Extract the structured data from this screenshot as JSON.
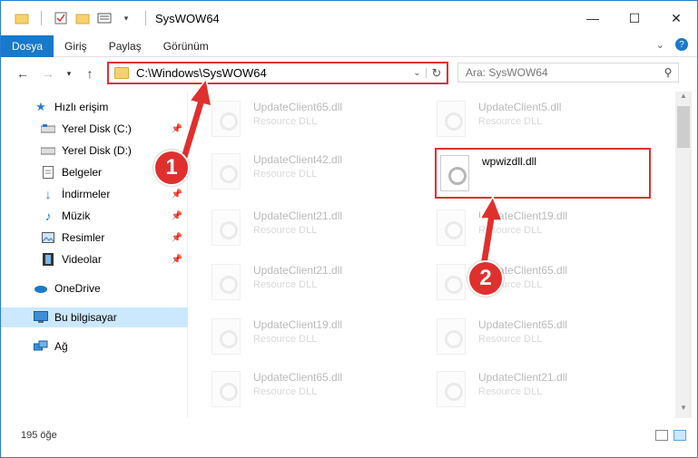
{
  "window": {
    "title": "SysWOW64"
  },
  "ribbon": {
    "tabs": [
      "Dosya",
      "Giriş",
      "Paylaş",
      "Görünüm"
    ]
  },
  "address": {
    "path": "C:\\Windows\\SysWOW64"
  },
  "search": {
    "placeholder": "Ara: SysWOW64"
  },
  "sidebar": {
    "items": [
      {
        "label": "Hızlı erişim",
        "icon": "star-icon"
      },
      {
        "label": "Yerel Disk (C:)",
        "icon": "drive-icon"
      },
      {
        "label": "Yerel Disk (D:)",
        "icon": "drive-icon"
      },
      {
        "label": "Belgeler",
        "icon": "documents-icon"
      },
      {
        "label": "İndirmeler",
        "icon": "download-icon"
      },
      {
        "label": "Müzik",
        "icon": "music-icon"
      },
      {
        "label": "Resimler",
        "icon": "pictures-icon"
      },
      {
        "label": "Videolar",
        "icon": "video-icon"
      },
      {
        "label": "OneDrive",
        "icon": "cloud-icon"
      },
      {
        "label": "Bu bilgisayar",
        "icon": "computer-icon"
      },
      {
        "label": "Ağ",
        "icon": "network-icon"
      }
    ]
  },
  "files": [
    {
      "name": "UpdateClient65.dll",
      "type": "Resource DLL"
    },
    {
      "name": "UpdateClient5.dll",
      "type": "Resource DLL"
    },
    {
      "name": "UpdateClient42.dll",
      "type": "Resource DLL"
    },
    {
      "name": "wpwizdll.dll",
      "type": ""
    },
    {
      "name": "UpdateClient21.dll",
      "type": "Resource DLL"
    },
    {
      "name": "UpdateClient19.dll",
      "type": "Resource DLL"
    },
    {
      "name": "UpdateClient21.dll",
      "type": "Resource DLL"
    },
    {
      "name": "UpdateClient65.dll",
      "type": "Resource DLL"
    },
    {
      "name": "UpdateClient19.dll",
      "type": "Resource DLL"
    },
    {
      "name": "UpdateClient65.dll",
      "type": "Resource DLL"
    },
    {
      "name": "UpdateClient65.dll",
      "type": "Resource DLL"
    },
    {
      "name": "UpdateClient21.dll",
      "type": "Resource DLL"
    }
  ],
  "status": {
    "count": "195 öğe"
  },
  "annotations": {
    "badge1": "1",
    "badge2": "2",
    "color": "#e0302e"
  }
}
